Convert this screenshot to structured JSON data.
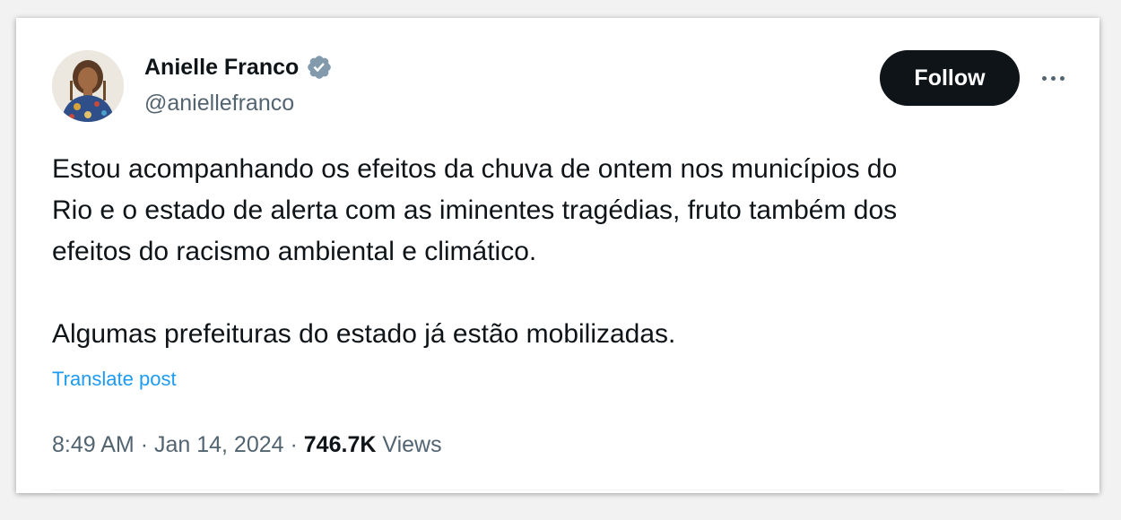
{
  "author": {
    "display_name": "Anielle Franco",
    "handle": "@aniellefranco",
    "verified": true
  },
  "actions": {
    "follow_label": "Follow",
    "more_icon": "more-horizontal-icon"
  },
  "tweet": {
    "text": "Estou acompanhando os efeitos da chuva de ontem nos municípios do\nRio e o estado de alerta com as iminentes tragédias, fruto também dos\nefeitos do racismo ambiental e climático.\n\nAlgumas prefeituras do estado já estão mobilizadas.",
    "translate_label": "Translate post",
    "time": "8:49 AM",
    "separator": "·",
    "date": "Jan 14, 2024",
    "views_count": "746.7K",
    "views_label": "Views"
  },
  "colors": {
    "text_primary": "#0f1419",
    "text_secondary": "#536471",
    "link": "#1d9bf0",
    "verified_badge": "#829aab",
    "button_bg": "#0f1419"
  }
}
